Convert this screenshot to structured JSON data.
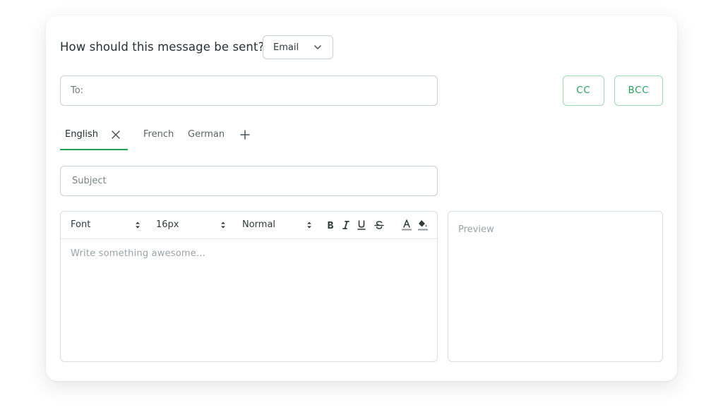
{
  "header": {
    "question": "How should this message be sent?"
  },
  "method_select": {
    "value": "Email"
  },
  "recipients": {
    "to_label": "To:",
    "cc_label": "CC",
    "bcc_label": "BCC"
  },
  "language_tabs": {
    "items": [
      {
        "label": "English",
        "active": true,
        "closable": true
      },
      {
        "label": "French",
        "active": false
      },
      {
        "label": "German",
        "active": false
      }
    ],
    "add_icon": "plus-icon",
    "close_icon": "close-icon"
  },
  "subject": {
    "placeholder": "Subject"
  },
  "editor": {
    "toolbar": {
      "font": "Font",
      "size": "16px",
      "style": "Normal",
      "format_buttons": [
        "bold-icon",
        "italic-icon",
        "underline-icon",
        "strikethrough-icon",
        "text-color-icon",
        "fill-color-icon"
      ]
    },
    "placeholder": "Write something awesome..."
  },
  "preview": {
    "label": "Preview"
  },
  "colors": {
    "accent": "#1fa055",
    "accent_border": "#9fd9b4",
    "border": "#c9cfd2"
  }
}
